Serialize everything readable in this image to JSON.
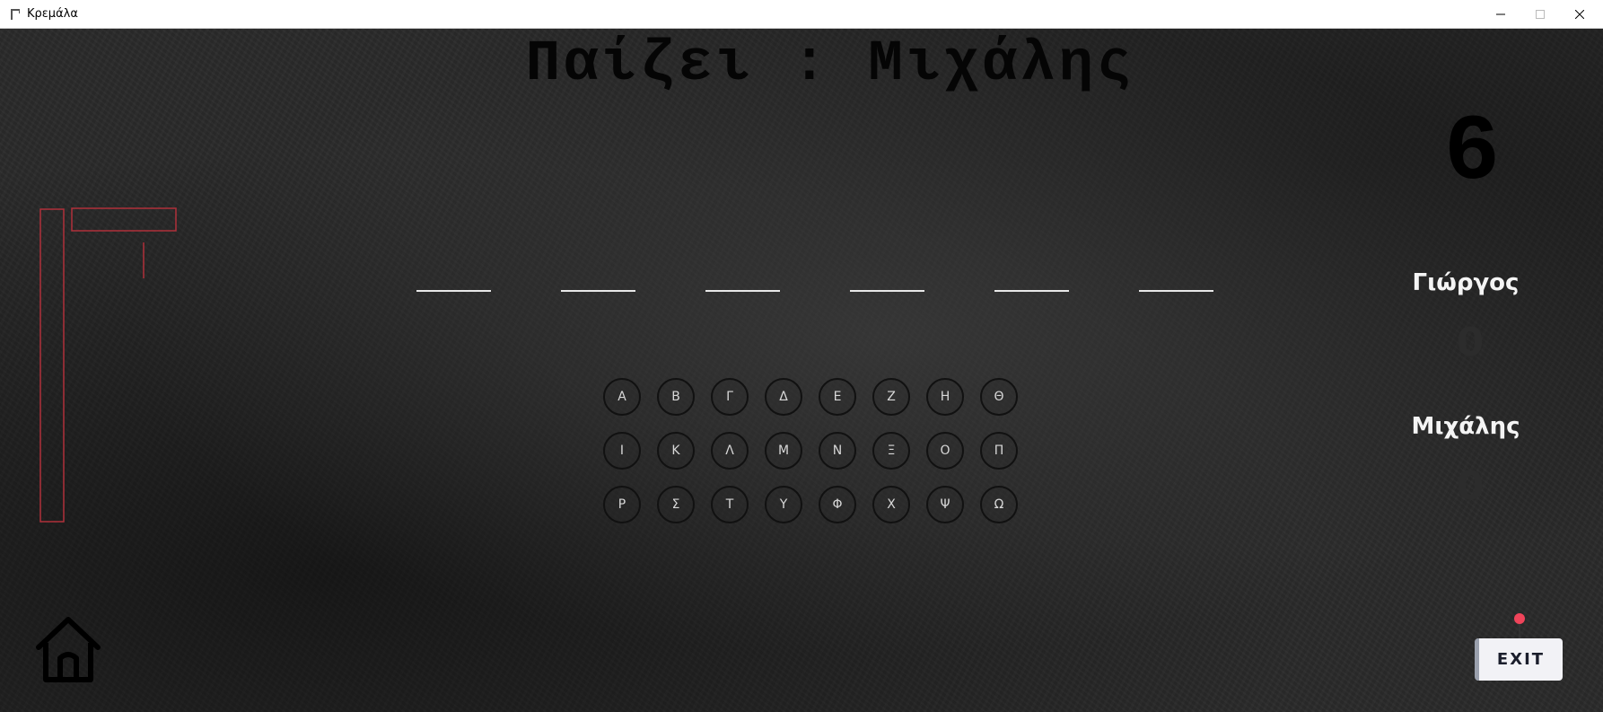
{
  "window": {
    "title": "Κρεμάλα",
    "icon": "gallows-icon"
  },
  "game": {
    "turn_label": "Παίζει : Μιχάλης",
    "remaining_attempts": "6",
    "word_length": 6,
    "letters_row1": [
      "Α",
      "Β",
      "Γ",
      "Δ",
      "Ε",
      "Ζ",
      "Η",
      "Θ"
    ],
    "letters_row2": [
      "Ι",
      "Κ",
      "Λ",
      "Μ",
      "Ν",
      "Ξ",
      "Ο",
      "Π"
    ],
    "letters_row3": [
      "Ρ",
      "Σ",
      "Τ",
      "Υ",
      "Φ",
      "Χ",
      "Ψ",
      "Ω"
    ]
  },
  "scores": {
    "player1": {
      "name": "Γιώργος",
      "score": "0"
    },
    "player2": {
      "name": "Μιχάλης",
      "score": "0"
    }
  },
  "controls": {
    "exit_label": "EXIT",
    "home_icon": "home-icon"
  },
  "colors": {
    "gallows": "#b0303a",
    "exit_dot": "#f0445a",
    "background": "#2a2a2a"
  }
}
